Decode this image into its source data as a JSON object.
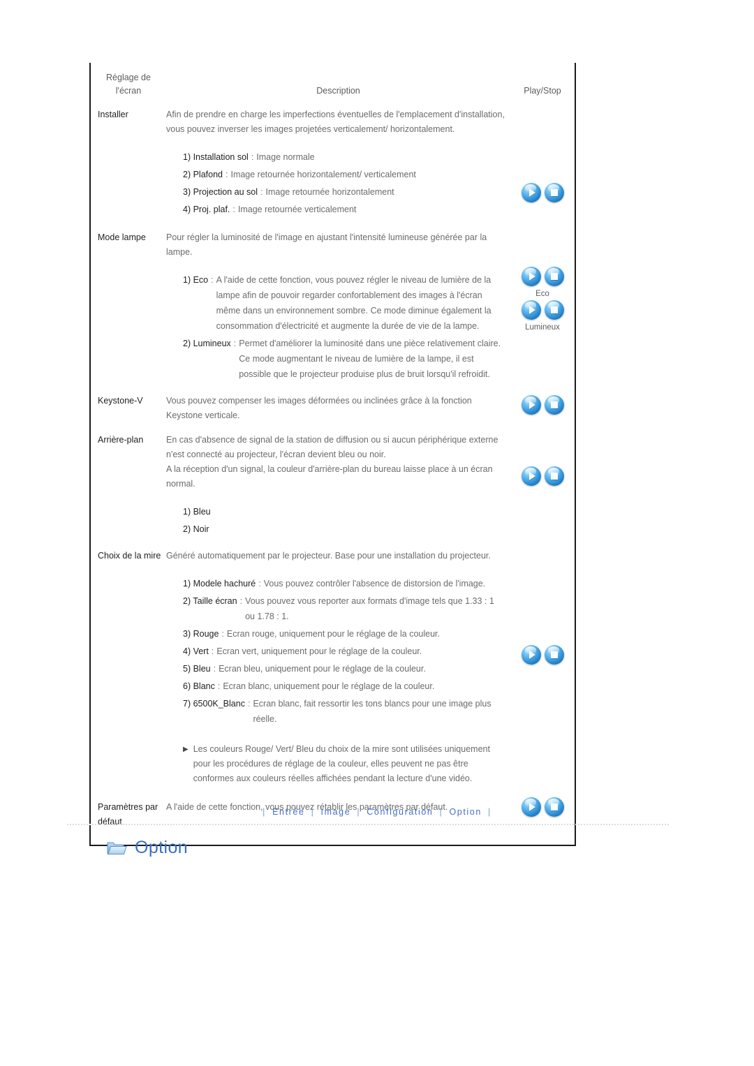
{
  "table": {
    "headers": {
      "setting": "Réglage de\nl'écran",
      "setting_line1": "Réglage de",
      "setting_line2": "l'écran",
      "description": "Description",
      "control": "Play/Stop"
    },
    "rows": [
      {
        "setting": "Installer",
        "paragraphs": [
          "Afin de prendre en charge les imperfections éventuelles de l'emplacement d'installation, vous pouvez inverser les images projetées verticalement/ horizontalement."
        ],
        "options": [
          {
            "key": "1) Installation sol",
            "sep": ":",
            "value": "Image normale"
          },
          {
            "key": "2) Plafond",
            "sep": ":",
            "value": "Image retournée horizontalement/ verticalement"
          },
          {
            "key": "3) Projection au sol",
            "sep": ":",
            "value": "Image retournée horizontalement"
          },
          {
            "key": "4) Proj. plaf.",
            "sep": ":",
            "value": "Image retournée verticalement"
          }
        ],
        "controls": [
          {
            "buttons": [
              "play-icon",
              "stop-icon"
            ],
            "caption": ""
          }
        ]
      },
      {
        "setting": "Mode lampe",
        "paragraphs": [
          "Pour régler la luminosité de l'image en ajustant l'intensité lumineuse générée par la lampe."
        ],
        "options": [
          {
            "key": "1) Eco",
            "sep": ":",
            "value": "A l'aide de cette fonction, vous pouvez régler le niveau de lumière de la lampe afin de pouvoir regarder confortablement des images à l'écran même dans un environnement sombre. Ce mode diminue également la consommation d'électricité et augmente la durée de vie de la lampe."
          },
          {
            "key": "2) Lumineux",
            "sep": ":",
            "value": "Permet d'améliorer la luminosité dans une pièce relativement claire. Ce mode augmentant le niveau de lumière de la lampe, il est possible que le projecteur produise plus de bruit lorsqu'il refroidit."
          }
        ],
        "controls": [
          {
            "buttons": [
              "play-icon",
              "stop-icon"
            ],
            "caption": "Eco"
          },
          {
            "buttons": [
              "play-icon",
              "stop-icon"
            ],
            "caption": "Lumineux"
          }
        ]
      },
      {
        "setting": "Keystone-V",
        "paragraphs": [
          "Vous pouvez compenser les images déformées ou inclinées grâce à la fonction Keystone verticale."
        ],
        "options": [],
        "controls": [
          {
            "buttons": [
              "play-icon",
              "stop-icon"
            ],
            "caption": ""
          }
        ]
      },
      {
        "setting": "Arrière-plan",
        "paragraphs": [
          "En cas d'absence de signal de la station de diffusion ou si aucun périphérique externe n'est connecté au projecteur, l'écran devient bleu ou noir.",
          "A la réception d'un signal, la couleur d'arrière-plan du bureau laisse place à un écran normal."
        ],
        "options": [
          {
            "key": "1) Bleu",
            "sep": "",
            "value": ""
          },
          {
            "key": "2) Noir",
            "sep": "",
            "value": ""
          }
        ],
        "controls": [
          {
            "buttons": [
              "play-icon",
              "stop-icon"
            ],
            "caption": ""
          }
        ]
      },
      {
        "setting": "Choix de la mire",
        "paragraphs": [
          "Généré automatiquement par le projecteur. Base pour une installation du projecteur."
        ],
        "options": [
          {
            "key": "1) Modele hachuré",
            "sep": ":",
            "value": "Vous pouvez contrôler l'absence de distorsion de l'image."
          },
          {
            "key": "2) Taille écran",
            "sep": ":",
            "value": "Vous pouvez vous reporter aux formats d'image tels que 1.33 : 1 ou 1.78 : 1."
          },
          {
            "key": "3) Rouge",
            "sep": ":",
            "value": "Ecran rouge, uniquement pour le réglage de la couleur."
          },
          {
            "key": "4) Vert",
            "sep": ":",
            "value": "Ecran vert, uniquement pour le réglage de la couleur."
          },
          {
            "key": "5) Bleu",
            "sep": ":",
            "value": "Ecran bleu, uniquement pour le réglage de la couleur."
          },
          {
            "key": "6) Blanc",
            "sep": ":",
            "value": "Ecran blanc, uniquement pour le réglage de la couleur."
          },
          {
            "key": "7) 6500K_Blanc",
            "sep": ":",
            "value": "Ecran blanc, fait ressortir les tons blancs pour une image plus réelle."
          }
        ],
        "note": "Les couleurs Rouge/ Vert/ Bleu du choix de la mire sont utilisées uniquement pour les procédures de réglage de la couleur, elles peuvent ne pas être conformes aux couleurs réelles affichées pendant la lecture d'une vidéo.",
        "note_bullet": "▶",
        "controls": [
          {
            "buttons": [
              "play-icon",
              "stop-icon"
            ],
            "caption": ""
          }
        ]
      },
      {
        "setting": "Paramètres par défaut",
        "setting_line1": "Paramètres par",
        "setting_line2": "défaut",
        "paragraphs": [
          "A l'aide de cette fonction, vous pouvez rétablir les paramètres par défaut."
        ],
        "options": [],
        "controls": [
          {
            "buttons": [
              "play-icon",
              "stop-icon"
            ],
            "caption": ""
          }
        ]
      }
    ]
  },
  "footer": {
    "separator": "|",
    "links": [
      {
        "label": "Entrée"
      },
      {
        "label": "Image"
      },
      {
        "label": "Configuration"
      },
      {
        "label": "Option"
      }
    ]
  },
  "section": {
    "title": "Option",
    "icon": "folder-icon"
  },
  "colors": {
    "accent_blue": "#3a6fc4",
    "link_blue": "#3f6fd0",
    "border_dark": "#1a1a1a",
    "body_text": "#6b6b6b",
    "key_text": "#1f1f1f",
    "button_blue": "#2d8fd8"
  }
}
